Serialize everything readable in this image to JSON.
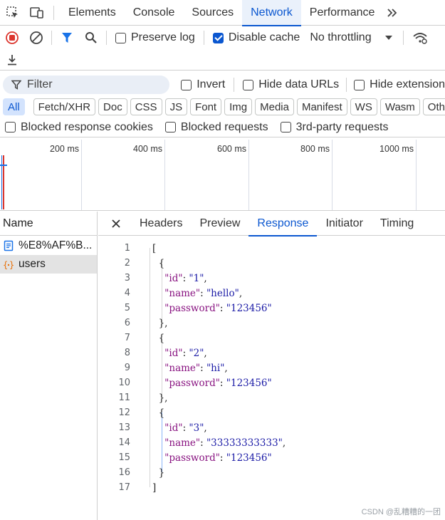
{
  "tabs": [
    "Elements",
    "Console",
    "Sources",
    "Network",
    "Performance"
  ],
  "active_tab": "Network",
  "toolbar": {
    "preserve_log": "Preserve log",
    "disable_cache": "Disable cache",
    "throttling": "No throttling"
  },
  "filter": {
    "placeholder": "Filter",
    "invert": "Invert",
    "hide_data_urls": "Hide data URLs",
    "hide_extension": "Hide extension"
  },
  "type_filters": [
    "All",
    "Fetch/XHR",
    "Doc",
    "CSS",
    "JS",
    "Font",
    "Img",
    "Media",
    "Manifest",
    "WS",
    "Wasm",
    "Oth"
  ],
  "blocked": {
    "cookies": "Blocked response cookies",
    "requests": "Blocked requests",
    "third_party": "3rd-party requests"
  },
  "timeline_ticks": [
    "200 ms",
    "400 ms",
    "600 ms",
    "800 ms",
    "1000 ms"
  ],
  "requests_header": "Name",
  "requests": [
    {
      "name": "%E8%AF%B...",
      "type": "document"
    },
    {
      "name": "users",
      "type": "xhr"
    }
  ],
  "detail_tabs": [
    "Headers",
    "Preview",
    "Response",
    "Initiator",
    "Timing"
  ],
  "active_detail_tab": "Response",
  "response_lines": [
    "[",
    "  {",
    "    \"id\": \"1\",",
    "    \"name\": \"hello\",",
    "    \"password\": \"123456\"",
    "  },",
    "  {",
    "    \"id\": \"2\",",
    "    \"name\": \"hi\",",
    "    \"password\": \"123456\"",
    "  },",
    "  {",
    "    \"id\": \"3\",",
    "    \"name\": \"33333333333\",",
    "    \"password\": \"123456\"",
    "  }",
    "]"
  ],
  "line_numbers": [
    "1",
    "2",
    "3",
    "4",
    "5",
    "6",
    "7",
    "8",
    "9",
    "10",
    "11",
    "12",
    "13",
    "14",
    "15",
    "16",
    "17"
  ],
  "watermark": "CSDN @乱糟糟的一团",
  "colors": {
    "accent": "#0b57d0",
    "record": "#dc362e",
    "filter_icon": "#1a73e8"
  }
}
